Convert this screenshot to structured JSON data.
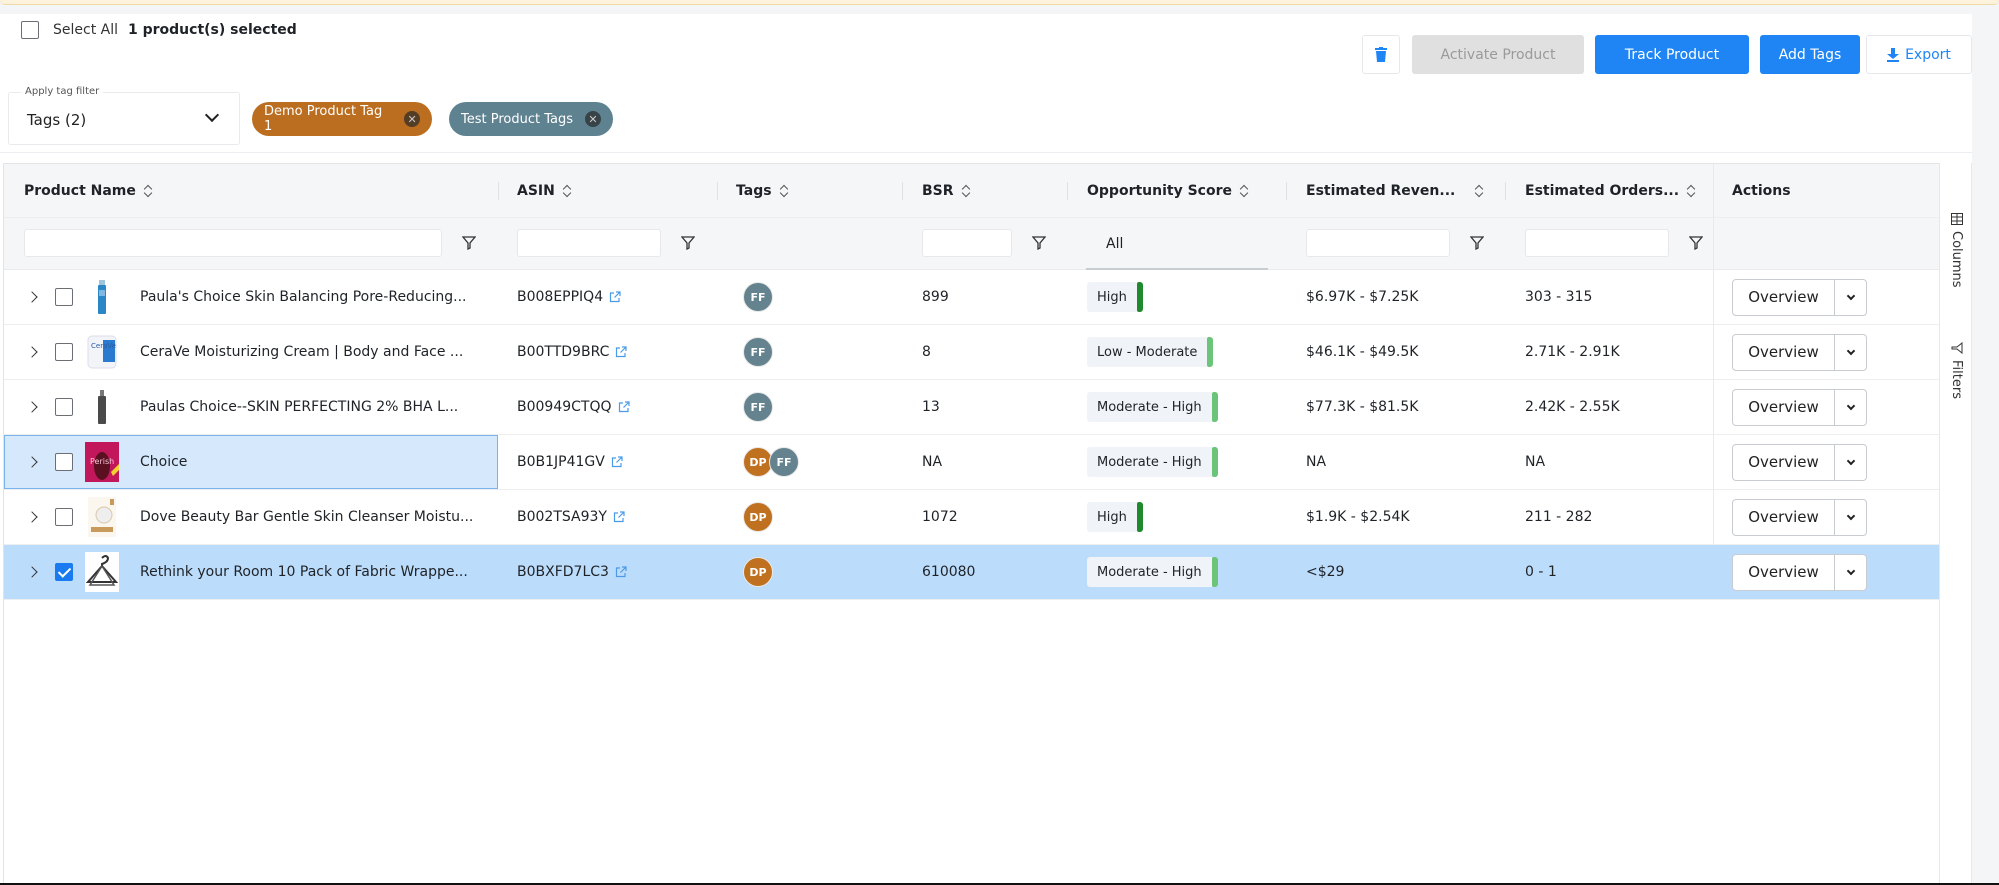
{
  "toolbar": {
    "select_all_label": "Select All",
    "selection_count": "1 product(s) selected",
    "buttons": {
      "delete_icon": "trash-icon",
      "activate": "Activate Product",
      "track": "Track Product",
      "add_tags": "Add Tags",
      "export": "Export",
      "export_icon": "download-icon"
    }
  },
  "tag_filter": {
    "legend": "Apply tag filter",
    "value": "Tags (2)",
    "chips": [
      {
        "label": "Demo Product Tag 1",
        "color": "#bb6e1f"
      },
      {
        "label": "Test Product Tags",
        "color": "#5f8291"
      }
    ]
  },
  "grid": {
    "columns": [
      {
        "key": "product_name",
        "label": "Product Name"
      },
      {
        "key": "asin",
        "label": "ASIN"
      },
      {
        "key": "tags",
        "label": "Tags"
      },
      {
        "key": "bsr",
        "label": "BSR"
      },
      {
        "key": "opportunity_score",
        "label": "Opportunity Score"
      },
      {
        "key": "est_revenue",
        "label": "Estimated Reven..."
      },
      {
        "key": "est_orders",
        "label": "Estimated Orders..."
      },
      {
        "key": "actions",
        "label": "Actions"
      }
    ],
    "opportunity_filter_value": "All",
    "rows": [
      {
        "name": "Paula's Choice Skin Balancing Pore-Reducing...",
        "asin": "B008EPPIQ4",
        "tags": [
          "FF"
        ],
        "bsr": "899",
        "score": "High",
        "score_color": "#1f8a2c",
        "revenue": "$6.97K - $7.25K",
        "orders": "303 - 315",
        "action": "Overview",
        "checked": false,
        "thumb": "blue-bottle"
      },
      {
        "name": "CeraVe Moisturizing Cream | Body and Face ...",
        "asin": "B00TTD9BRC",
        "tags": [
          "FF"
        ],
        "bsr": "8",
        "score": "Low - Moderate",
        "score_color": "#6cc47a",
        "revenue": "$46.1K - $49.5K",
        "orders": "2.71K - 2.91K",
        "action": "Overview",
        "checked": false,
        "thumb": "cream-tub"
      },
      {
        "name": "Paulas Choice--SKIN PERFECTING 2% BHA L...",
        "asin": "B00949CTQQ",
        "tags": [
          "FF"
        ],
        "bsr": "13",
        "score": "Moderate - High",
        "score_color": "#6cc47a",
        "revenue": "$77.3K - $81.5K",
        "orders": "2.42K - 2.55K",
        "action": "Overview",
        "checked": false,
        "thumb": "dark-bottle"
      },
      {
        "name": "Choice",
        "asin": "B0B1JP41GV",
        "tags": [
          "DP",
          "FF"
        ],
        "bsr": "NA",
        "score": "Moderate - High",
        "score_color": "#6cc47a",
        "revenue": "NA",
        "orders": "NA",
        "action": "Overview",
        "checked": false,
        "thumb": "book-cover"
      },
      {
        "name": "Dove Beauty Bar Gentle Skin Cleanser Moistu...",
        "asin": "B002TSA93Y",
        "tags": [
          "DP"
        ],
        "bsr": "1072",
        "score": "High",
        "score_color": "#1f8a2c",
        "revenue": "$1.9K - $2.54K",
        "orders": "211 - 282",
        "action": "Overview",
        "checked": false,
        "thumb": "soap-bar"
      },
      {
        "name": "Rethink your Room 10 Pack of Fabric Wrappe...",
        "asin": "B0BXFD7LC3",
        "tags": [
          "DP"
        ],
        "bsr": "610080",
        "score": "Moderate - High",
        "score_color": "#6cc47a",
        "revenue": "<$29",
        "orders": "0 - 1",
        "action": "Overview",
        "checked": true,
        "thumb": "hanger"
      }
    ]
  },
  "side_panel": {
    "columns_label": "Columns",
    "filters_label": "Filters"
  },
  "colors": {
    "primary": "#1f85f4",
    "selected_row": "#bcdcfb",
    "tag_ff": "#64838f",
    "tag_dp": "#bf711f"
  }
}
